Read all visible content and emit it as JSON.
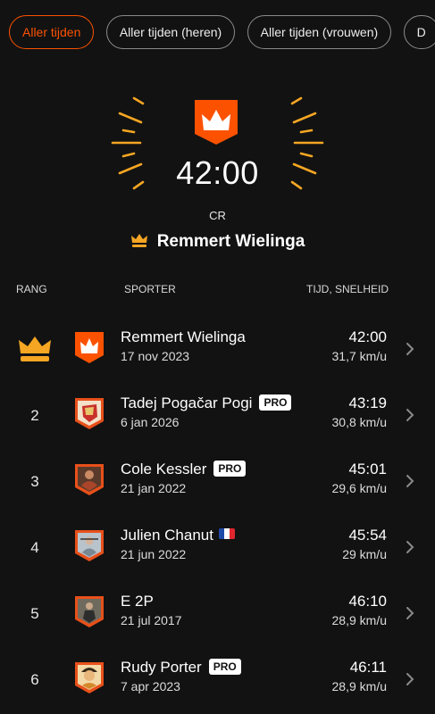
{
  "filters": [
    {
      "label": "Aller tijden",
      "active": true
    },
    {
      "label": "Aller tijden (heren)",
      "active": false
    },
    {
      "label": "Aller tijden (vrouwen)",
      "active": false
    },
    {
      "label": "D",
      "active": false
    }
  ],
  "hero": {
    "time": "42:00",
    "label": "CR",
    "holder": "Remmert Wielinga"
  },
  "table": {
    "col_rank": "RANG",
    "col_athlete": "SPORTER",
    "col_time": "TIJD, SNELHEID"
  },
  "rows": [
    {
      "rank": "1",
      "name": "Remmert Wielinga",
      "date": "17 nov 2023",
      "time": "42:00",
      "speed": "31,7 km/u",
      "pro": false,
      "crown": true
    },
    {
      "rank": "2",
      "name": "Tadej Pogačar Pogi",
      "date": "6 jan 2026",
      "time": "43:19",
      "speed": "30,8 km/u",
      "pro": true,
      "pro_label": "PRO"
    },
    {
      "rank": "3",
      "name": "Cole Kessler",
      "date": "21 jan 2022",
      "time": "45:01",
      "speed": "29,6 km/u",
      "pro": true,
      "pro_label": "PRO"
    },
    {
      "rank": "4",
      "name": "Julien Chanut",
      "date": "21 jun 2022",
      "time": "45:54",
      "speed": "29 km/u",
      "pro": false,
      "flag": "france-flag-icon"
    },
    {
      "rank": "5",
      "name": "E 2P",
      "date": "21 jul 2017",
      "time": "46:10",
      "speed": "28,9 km/u",
      "pro": false
    },
    {
      "rank": "6",
      "name": "Rudy Porter",
      "date": "7 apr 2023",
      "time": "46:11",
      "speed": "28,9 km/u",
      "pro": true,
      "pro_label": "PRO"
    }
  ],
  "colors": {
    "accent": "#fc5200",
    "gold": "#f5a623",
    "background": "#121212"
  }
}
